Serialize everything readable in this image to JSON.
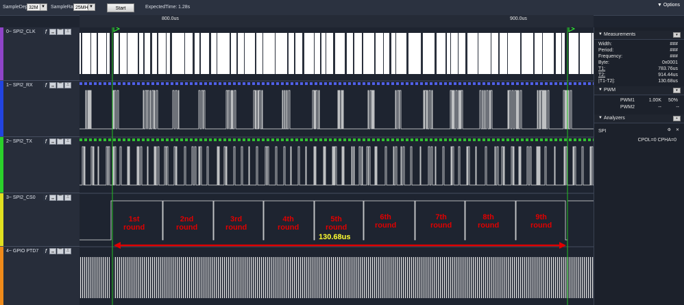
{
  "toolbar": {
    "sample_depth_label": "SampleDepth",
    "sample_depth_value": "32M",
    "sample_rate_label": "SampleRate",
    "sample_rate_value": "25MHz",
    "start_label": "Start",
    "expected_time_label": "ExpectedTime:",
    "expected_time_value": "1.28s",
    "options_label": "Options"
  },
  "timeline": {
    "ticks": [
      "800.0us",
      "900.0us"
    ]
  },
  "channels": [
    {
      "label": "0~ SPI2_CLK",
      "color": "#8f44c8"
    },
    {
      "label": "1~ SPI2_RX",
      "color": "#2244e0"
    },
    {
      "label": "2~ SPI2_TX",
      "color": "#2bd12b"
    },
    {
      "label": "3~ SPI2_CS0",
      "color": "#e0e020"
    },
    {
      "label": "4~ GPIO PTD7",
      "color": "#ef8a1a"
    }
  ],
  "rounds": [
    [
      "1st",
      "round"
    ],
    [
      "2nd",
      "round"
    ],
    [
      "3rd",
      "round"
    ],
    [
      "4th",
      "round"
    ],
    [
      "5th",
      "round"
    ],
    [
      "6th",
      "round"
    ],
    [
      "7th",
      "round"
    ],
    [
      "8th",
      "round"
    ],
    [
      "9th",
      "round"
    ]
  ],
  "measure_annotation": "130.68us",
  "measurements": {
    "title": "Measurements",
    "rows": [
      {
        "label": "Width:",
        "value": "###"
      },
      {
        "label": "Period:",
        "value": "###"
      },
      {
        "label": "Frequency:",
        "value": "###"
      },
      {
        "label": "Byte:",
        "value": "0x0001"
      },
      {
        "label": "T1:",
        "value": "783.76us"
      },
      {
        "label": "T2:",
        "value": "914.44us"
      },
      {
        "label": "|T1-T2|:",
        "value": "130.68us"
      }
    ]
  },
  "pwm": {
    "title": "PWM",
    "rows": [
      {
        "label": "PWM1",
        "freq": "1.00K",
        "duty": "50%"
      },
      {
        "label": "PWM2",
        "freq": "--",
        "duty": "--"
      }
    ]
  },
  "analyzers": {
    "title": "Analyzers",
    "name": "SPI",
    "config": "CPOL=0 CPHA=0"
  }
}
